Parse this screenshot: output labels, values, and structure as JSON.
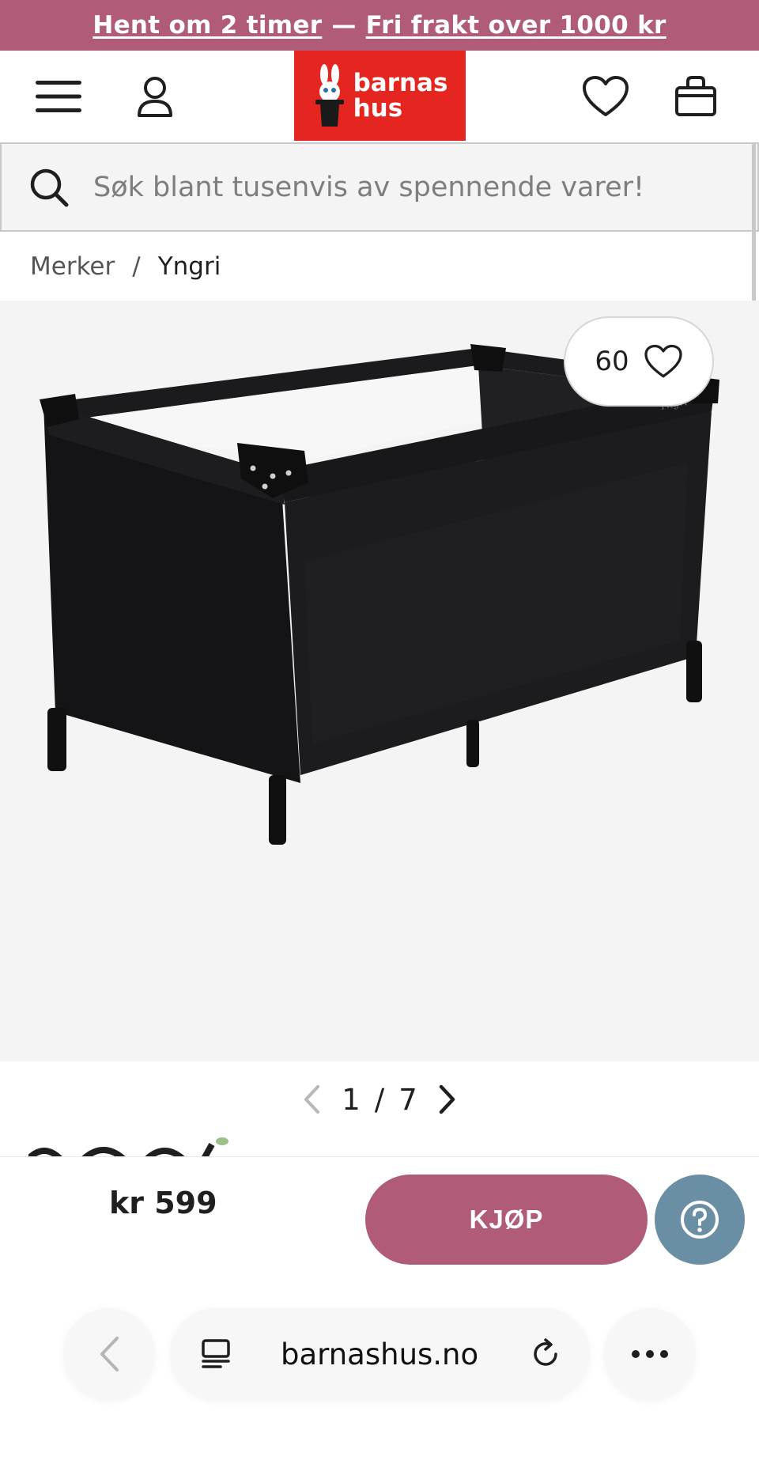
{
  "promo": {
    "pickup": "Hent om 2 timer",
    "separator": "—",
    "shipping": "Fri frakt over 1000 kr"
  },
  "header": {
    "logo_line1": "barnas",
    "logo_line2": "hus"
  },
  "search": {
    "placeholder": "Søk blant tusenvis av spennende varer!"
  },
  "breadcrumb": {
    "items": [
      "Merker",
      "Yngri"
    ],
    "separator": "/"
  },
  "product": {
    "favorite_count": "60",
    "image_brand_mark": "Yngri"
  },
  "gallery": {
    "current": "1",
    "separator": "/",
    "total": "7"
  },
  "buy_bar": {
    "price": "kr 599",
    "buy_label": "KJØP"
  },
  "browser": {
    "url": "barnashus.no"
  },
  "colors": {
    "brand_pink": "#b05b78",
    "logo_red": "#e52620",
    "help_blue": "#6a8ea3"
  },
  "icons": [
    "menu-icon",
    "user-icon",
    "heart-icon",
    "bag-icon",
    "search-icon",
    "chevron-left-icon",
    "chevron-right-icon",
    "help-icon",
    "reader-icon",
    "reload-icon",
    "more-icon"
  ]
}
